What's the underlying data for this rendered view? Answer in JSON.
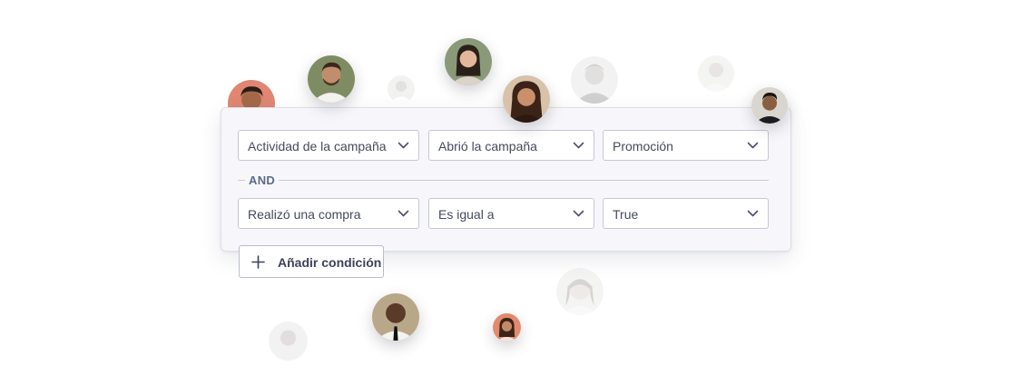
{
  "conditions": [
    {
      "field": "Actividad de la campaña",
      "operator": "Abrió la campaña",
      "value": "Promoción"
    },
    {
      "field": "Realizó una compra",
      "operator": "Es igual a",
      "value": "True"
    }
  ],
  "connector": "AND",
  "add_condition_label": "Añadir condición",
  "icons": {
    "dropdown": "chevron-down-icon",
    "add": "plus-icon"
  },
  "colors": {
    "panel_bg": "#f7f7fb",
    "select_border": "#c5c7d6",
    "text": "#454a5e",
    "connector": "#5c6a8c"
  }
}
